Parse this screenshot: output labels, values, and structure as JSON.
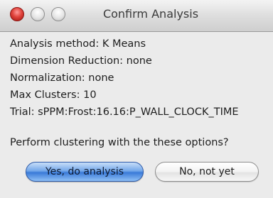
{
  "window": {
    "title": "Confirm Analysis"
  },
  "analysis": {
    "lines": [
      "Analysis method: K Means",
      "Dimension Reduction: none",
      "Normalization: none",
      "Max Clusters: 10",
      "Trial: sPPM:Frost:16.16:P_WALL_CLOCK_TIME"
    ],
    "prompt": "Perform clustering with the these options?"
  },
  "buttons": {
    "confirm_label": "Yes, do analysis",
    "cancel_label": "No, not yet"
  },
  "colors": {
    "close_button": "#e0443c",
    "default_button": "#3a7ad8",
    "window_background": "#ebebeb"
  }
}
